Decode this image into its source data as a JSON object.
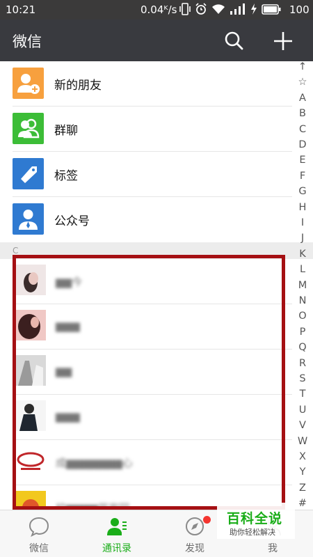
{
  "status_bar": {
    "time": "10:21",
    "net_speed": "0.04ᴷ/s",
    "battery": "100"
  },
  "header": {
    "title": "微信"
  },
  "functions": [
    {
      "label": "新的朋友",
      "icon": "new-friend-icon",
      "color": "#f7a03e"
    },
    {
      "label": "群聊",
      "icon": "group-chat-icon",
      "color": "#3cbd37"
    },
    {
      "label": "标签",
      "icon": "tag-icon",
      "color": "#2f7ad1"
    },
    {
      "label": "公众号",
      "icon": "official-account-icon",
      "color": "#2f7ad1"
    }
  ],
  "section": {
    "letter": "C"
  },
  "contacts": [
    {
      "name": "▆▆今"
    },
    {
      "name": "▆▆▆"
    },
    {
      "name": "▆▆"
    },
    {
      "name": "▆▆▆"
    },
    {
      "name": "成▆▆▆▆▆▆▆心"
    },
    {
      "name": "校▆▆▆▆苗家园"
    }
  ],
  "index_letters": [
    "↑",
    "☆",
    "A",
    "B",
    "C",
    "D",
    "E",
    "F",
    "G",
    "H",
    "I",
    "J",
    "K",
    "L",
    "M",
    "N",
    "O",
    "P",
    "Q",
    "R",
    "S",
    "T",
    "U",
    "V",
    "W",
    "X",
    "Y",
    "Z",
    "#"
  ],
  "tabs": [
    {
      "label": "微信",
      "icon": "chat-bubble-icon"
    },
    {
      "label": "通讯录",
      "icon": "contacts-icon",
      "active": true
    },
    {
      "label": "发现",
      "icon": "compass-icon"
    },
    {
      "label": "我",
      "icon": "me-icon"
    }
  ],
  "watermark": {
    "title": "百科全说",
    "subtitle": "助你轻松解决"
  },
  "colors": {
    "accent_green": "#1aad19",
    "header_bg": "#393a3f",
    "highlight_border": "#a51013"
  }
}
